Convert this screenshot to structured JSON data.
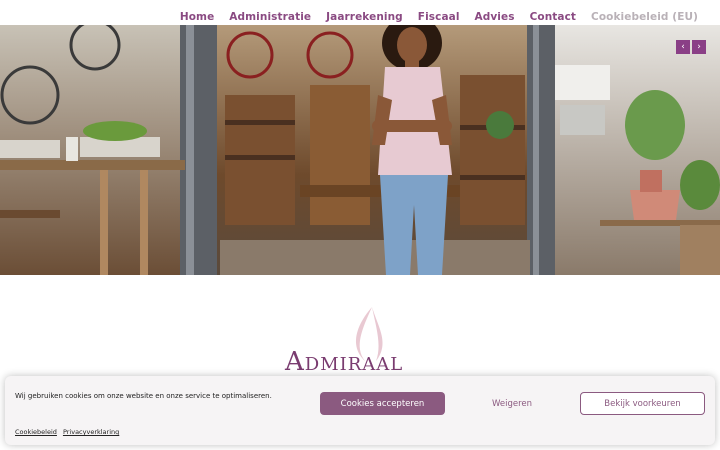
{
  "nav": {
    "items": [
      {
        "label": "Home"
      },
      {
        "label": "Administratie"
      },
      {
        "label": "Jaarrekening"
      },
      {
        "label": "Fiscaal"
      },
      {
        "label": "Advies"
      },
      {
        "label": "Contact"
      },
      {
        "label": "Cookiebeleid (EU)"
      }
    ]
  },
  "hero": {
    "prev_icon": "chevron-left-icon",
    "next_icon": "chevron-right-icon",
    "prev_glyph": "‹",
    "next_glyph": "›"
  },
  "logo": {
    "text": "Admiraal"
  },
  "cookie": {
    "message": "Wij gebruiken cookies om onze website en onze service te optimaliseren.",
    "accept_label": "Cookies accepteren",
    "deny_label": "Weigeren",
    "prefs_label": "Bekijk voorkeuren",
    "links": [
      {
        "label": "Cookiebeleid"
      },
      {
        "label": "Privacyverklaring"
      }
    ]
  },
  "colors": {
    "brand": "#8a4a82",
    "button": "#8b5a80",
    "arrow_bg": "#8a3f86"
  }
}
